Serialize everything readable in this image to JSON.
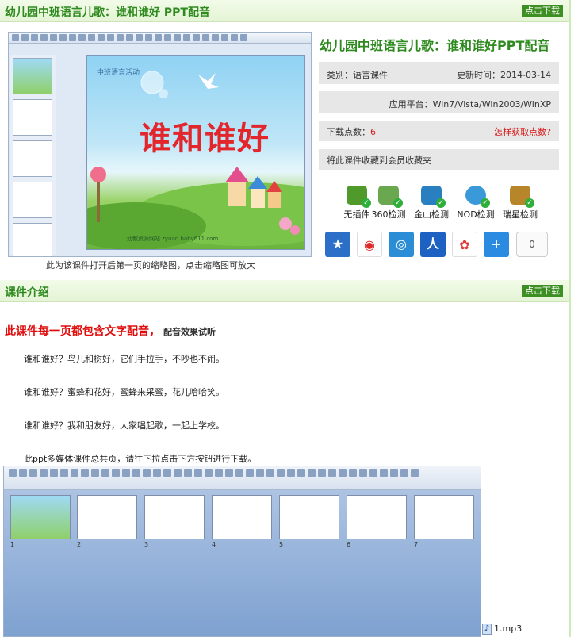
{
  "header": {
    "title": "幼儿园中班语言儿歌：谁和谁好 PPT配音",
    "download_label": "点击下载"
  },
  "preview": {
    "slide_subtitle": "中班语言活动",
    "slide_title": "谁和谁好",
    "slide_url": "幼教资源网站 zyuan.baby611.com",
    "caption": "此为该课件打开后第一页的缩略图，点击缩略图可放大"
  },
  "info": {
    "title": "幼儿园中班语言儿歌：谁和谁好PPT配音",
    "category_label": "类别：语言课件",
    "update_label": "更新时间：2014-03-14",
    "platform_label": "应用平台：Win7/Vista/Win2003/WinXP",
    "points_label": "下载点数：",
    "points_value": "6",
    "how_to_get": "怎样获取点数?",
    "favorite": "将此课件收藏到会员收藏夹",
    "checks": [
      "无插件",
      "360检测",
      "金山检测",
      "NOD检测",
      "瑞星检测"
    ],
    "share_count": "0"
  },
  "intro": {
    "section_title": "课件介绍",
    "download_label": "点击下载",
    "headline": "此课件每一页都包含文字配音，",
    "headline_small": "配音效果试听",
    "paragraphs": [
      "谁和谁好？鸟儿和树好，它们手拉手，不吵也不闹。",
      "谁和谁好？蜜蜂和花好，蜜蜂来采蜜，花儿哈哈笑。",
      "谁和谁好？我和朋友好，大家唱起歌，一起上学校。",
      "此ppt多媒体课件总共页，请往下拉点击下方按钮进行下载。"
    ],
    "audio_file": "1.mp3"
  },
  "colors": {
    "brand_green": "#2e8a1e",
    "button_green": "#3d8e23",
    "red": "#d71a1a"
  }
}
